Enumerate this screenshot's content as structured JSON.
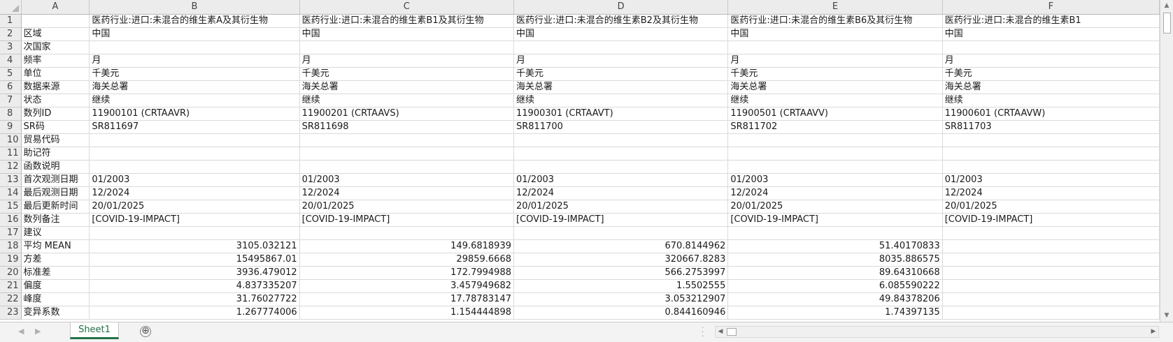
{
  "columns": [
    "A",
    "B",
    "C",
    "D",
    "E",
    "F"
  ],
  "rows": [
    {
      "n": "1",
      "a": "",
      "cells": [
        "医药行业:进口:未混合的维生素A及其衍生物",
        "医药行业:进口:未混合的维生素B1及其衍生物",
        "医药行业:进口:未混合的维生素B2及其衍生物",
        "医药行业:进口:未混合的维生素B6及其衍生物",
        "医药行业:进口:未混合的维生素B1"
      ]
    },
    {
      "n": "2",
      "a": "区域",
      "cells": [
        "中国",
        "中国",
        "中国",
        "中国",
        "中国"
      ]
    },
    {
      "n": "3",
      "a": "次国家",
      "cells": [
        "",
        "",
        "",
        "",
        ""
      ]
    },
    {
      "n": "4",
      "a": "频率",
      "cells": [
        "月",
        "月",
        "月",
        "月",
        "月"
      ]
    },
    {
      "n": "5",
      "a": "单位",
      "cells": [
        "千美元",
        "千美元",
        "千美元",
        "千美元",
        "千美元"
      ]
    },
    {
      "n": "6",
      "a": "数据来源",
      "cells": [
        "海关总署",
        "海关总署",
        "海关总署",
        "海关总署",
        "海关总署"
      ]
    },
    {
      "n": "7",
      "a": "状态",
      "cells": [
        "继续",
        "继续",
        "继续",
        "继续",
        "继续"
      ]
    },
    {
      "n": "8",
      "a": "数列ID",
      "cells": [
        "11900101 (CRTAAVR)",
        "11900201 (CRTAAVS)",
        "11900301 (CRTAAVT)",
        "11900501 (CRTAAVV)",
        "11900601 (CRTAAVW)"
      ]
    },
    {
      "n": "9",
      "a": "SR码",
      "cells": [
        "SR811697",
        "SR811698",
        "SR811700",
        "SR811702",
        "SR811703"
      ]
    },
    {
      "n": "10",
      "a": "贸易代码",
      "cells": [
        "",
        "",
        "",
        "",
        ""
      ]
    },
    {
      "n": "11",
      "a": "助记符",
      "cells": [
        "",
        "",
        "",
        "",
        ""
      ]
    },
    {
      "n": "12",
      "a": "函数说明",
      "cells": [
        "",
        "",
        "",
        "",
        ""
      ]
    },
    {
      "n": "13",
      "a": "首次观测日期",
      "cells": [
        "01/2003",
        "01/2003",
        "01/2003",
        "01/2003",
        "01/2003"
      ]
    },
    {
      "n": "14",
      "a": "最后观测日期",
      "cells": [
        "12/2024",
        "12/2024",
        "12/2024",
        "12/2024",
        "12/2024"
      ]
    },
    {
      "n": "15",
      "a": "最后更新时间",
      "cells": [
        "20/01/2025",
        "20/01/2025",
        "20/01/2025",
        "20/01/2025",
        "20/01/2025"
      ]
    },
    {
      "n": "16",
      "a": "数列备注",
      "cells": [
        "[COVID-19-IMPACT]",
        "[COVID-19-IMPACT]",
        "[COVID-19-IMPACT]",
        "[COVID-19-IMPACT]",
        "[COVID-19-IMPACT]"
      ]
    },
    {
      "n": "17",
      "a": "建议",
      "cells": [
        "",
        "",
        "",
        "",
        ""
      ]
    },
    {
      "n": "18",
      "a": "平均 MEAN",
      "num": true,
      "cells": [
        "3105.032121",
        "149.6818939",
        "670.8144962",
        "51.40170833",
        ""
      ]
    },
    {
      "n": "19",
      "a": "方差",
      "num": true,
      "cells": [
        "15495867.01",
        "29859.6668",
        "320667.8283",
        "8035.886575",
        ""
      ]
    },
    {
      "n": "20",
      "a": "标准差",
      "num": true,
      "cells": [
        "3936.479012",
        "172.7994988",
        "566.2753997",
        "89.64310668",
        ""
      ]
    },
    {
      "n": "21",
      "a": "偏度",
      "num": true,
      "cells": [
        "4.837335207",
        "3.457949682",
        "1.5502555",
        "6.085590222",
        ""
      ]
    },
    {
      "n": "22",
      "a": "峰度",
      "num": true,
      "cells": [
        "31.76027722",
        "17.78783147",
        "3.053212907",
        "49.84378206",
        ""
      ]
    },
    {
      "n": "23",
      "a": "变异系数",
      "num": true,
      "cells": [
        "1.267774006",
        "1.154444898",
        "0.844160946",
        "1.74397135",
        ""
      ]
    }
  ],
  "sheet_tab": "Sheet1",
  "add_sheet_symbol": "⊕",
  "icons": {
    "scroll_up": "triangle-up-icon",
    "scroll_down": "triangle-down-icon",
    "scroll_left": "triangle-left-icon",
    "scroll_right": "triangle-right-icon",
    "add_sheet": "plus-circle-icon"
  },
  "colors": {
    "accent": "#217346",
    "header_bg": "#ececec",
    "gridline": "#dadada"
  }
}
